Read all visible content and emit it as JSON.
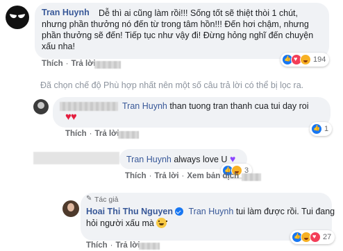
{
  "comments": [
    {
      "author": "Tran Huynh",
      "text": "Dễ thì ai cũng làm rồi!!! Sống tốt sẽ thiệt thòi 1 chút, nhưng phần thưởng nó đến từ trong tâm hồn!!! Đến hơi chậm, nhưng phần thưởng sẽ đến! Tiếp tục như vậy đi! Đừng hỏng nghĩ đến chuyện xấu nha!",
      "lines": [
        "Dễ thì ai cũng làm rồi!!! Sống tốt sẽ thiệt thòi 1 chút,",
        "nhưng phần thưởng nó đến từ trong tâm hồn!!! Đến hơi chậm, nhưng",
        "phần thưởng sẽ đến! Tiếp tục như vậy đi! Đừng hỏng nghĩ đến chuyện",
        "xấu nha!"
      ],
      "actions": [
        "Thích",
        "Trả lời"
      ],
      "reaction_count": "194"
    },
    {
      "mention": "Tran Huynh",
      "text": "than tuong tran thanh cua tui day roi",
      "actions": [
        "Thích",
        "Trả lời"
      ],
      "reaction_count": "1"
    },
    {
      "mention": "Tran Huynh",
      "text": "always love U",
      "actions": [
        "Thích",
        "Trả lời",
        "Xem bản dịch"
      ],
      "reaction_count": "3"
    },
    {
      "badge": "Tác giả",
      "author": "Hoai Thi Thu Nguyen",
      "mention": "Tran Huynh",
      "text_line1": "tui làm được rồi. Tui đang",
      "text_line2": "hỏi người xấu mà",
      "actions": [
        "Thích",
        "Trả lời"
      ],
      "reaction_count": "27"
    }
  ],
  "filter_note": "Đã chọn chế độ Phù hợp nhất nên một số câu trả lời có thể bị lọc ra.",
  "separator": "·"
}
